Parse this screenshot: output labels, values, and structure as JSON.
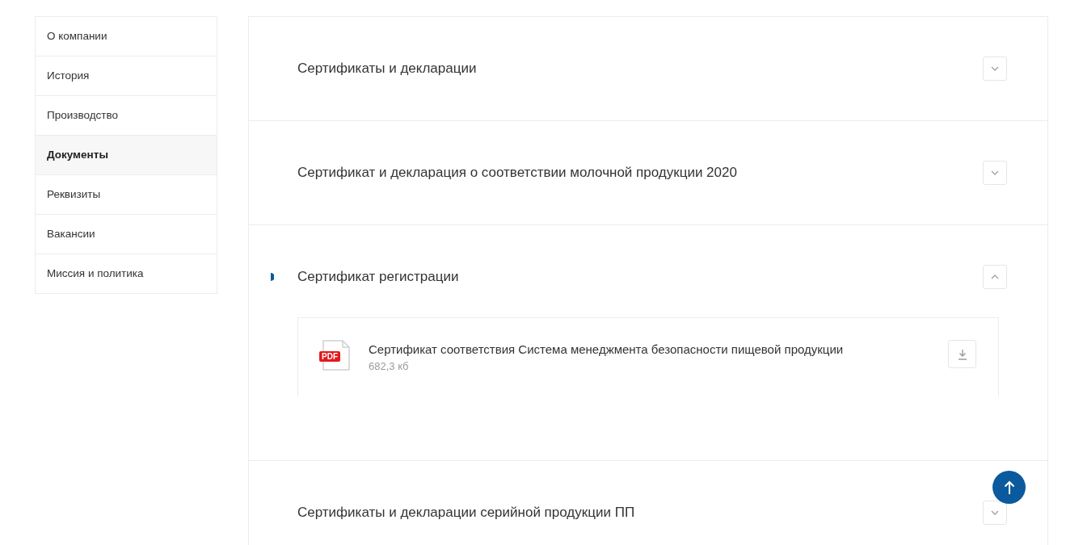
{
  "sidebar": {
    "items": [
      {
        "label": "О компании",
        "selected": false
      },
      {
        "label": "История",
        "selected": false
      },
      {
        "label": "Производство",
        "selected": false
      },
      {
        "label": "Документы",
        "selected": true
      },
      {
        "label": "Реквизиты",
        "selected": false
      },
      {
        "label": "Вакансии",
        "selected": false
      },
      {
        "label": "Миссия и политика",
        "selected": false
      }
    ]
  },
  "sections": [
    {
      "title": "Сертификаты и декларации",
      "expanded": false
    },
    {
      "title": "Сертификат и декларация о соответствии молочной продукции 2020",
      "expanded": false
    },
    {
      "title": "Сертификат регистрации",
      "expanded": true,
      "files": [
        {
          "type": "PDF",
          "name": "Сертификат соответствия Система менеджмента безопасности пищевой продукции",
          "size": "682,3 кб"
        }
      ]
    },
    {
      "title": "Сертификаты и декларации серийной продукции ПП",
      "expanded": false
    }
  ]
}
